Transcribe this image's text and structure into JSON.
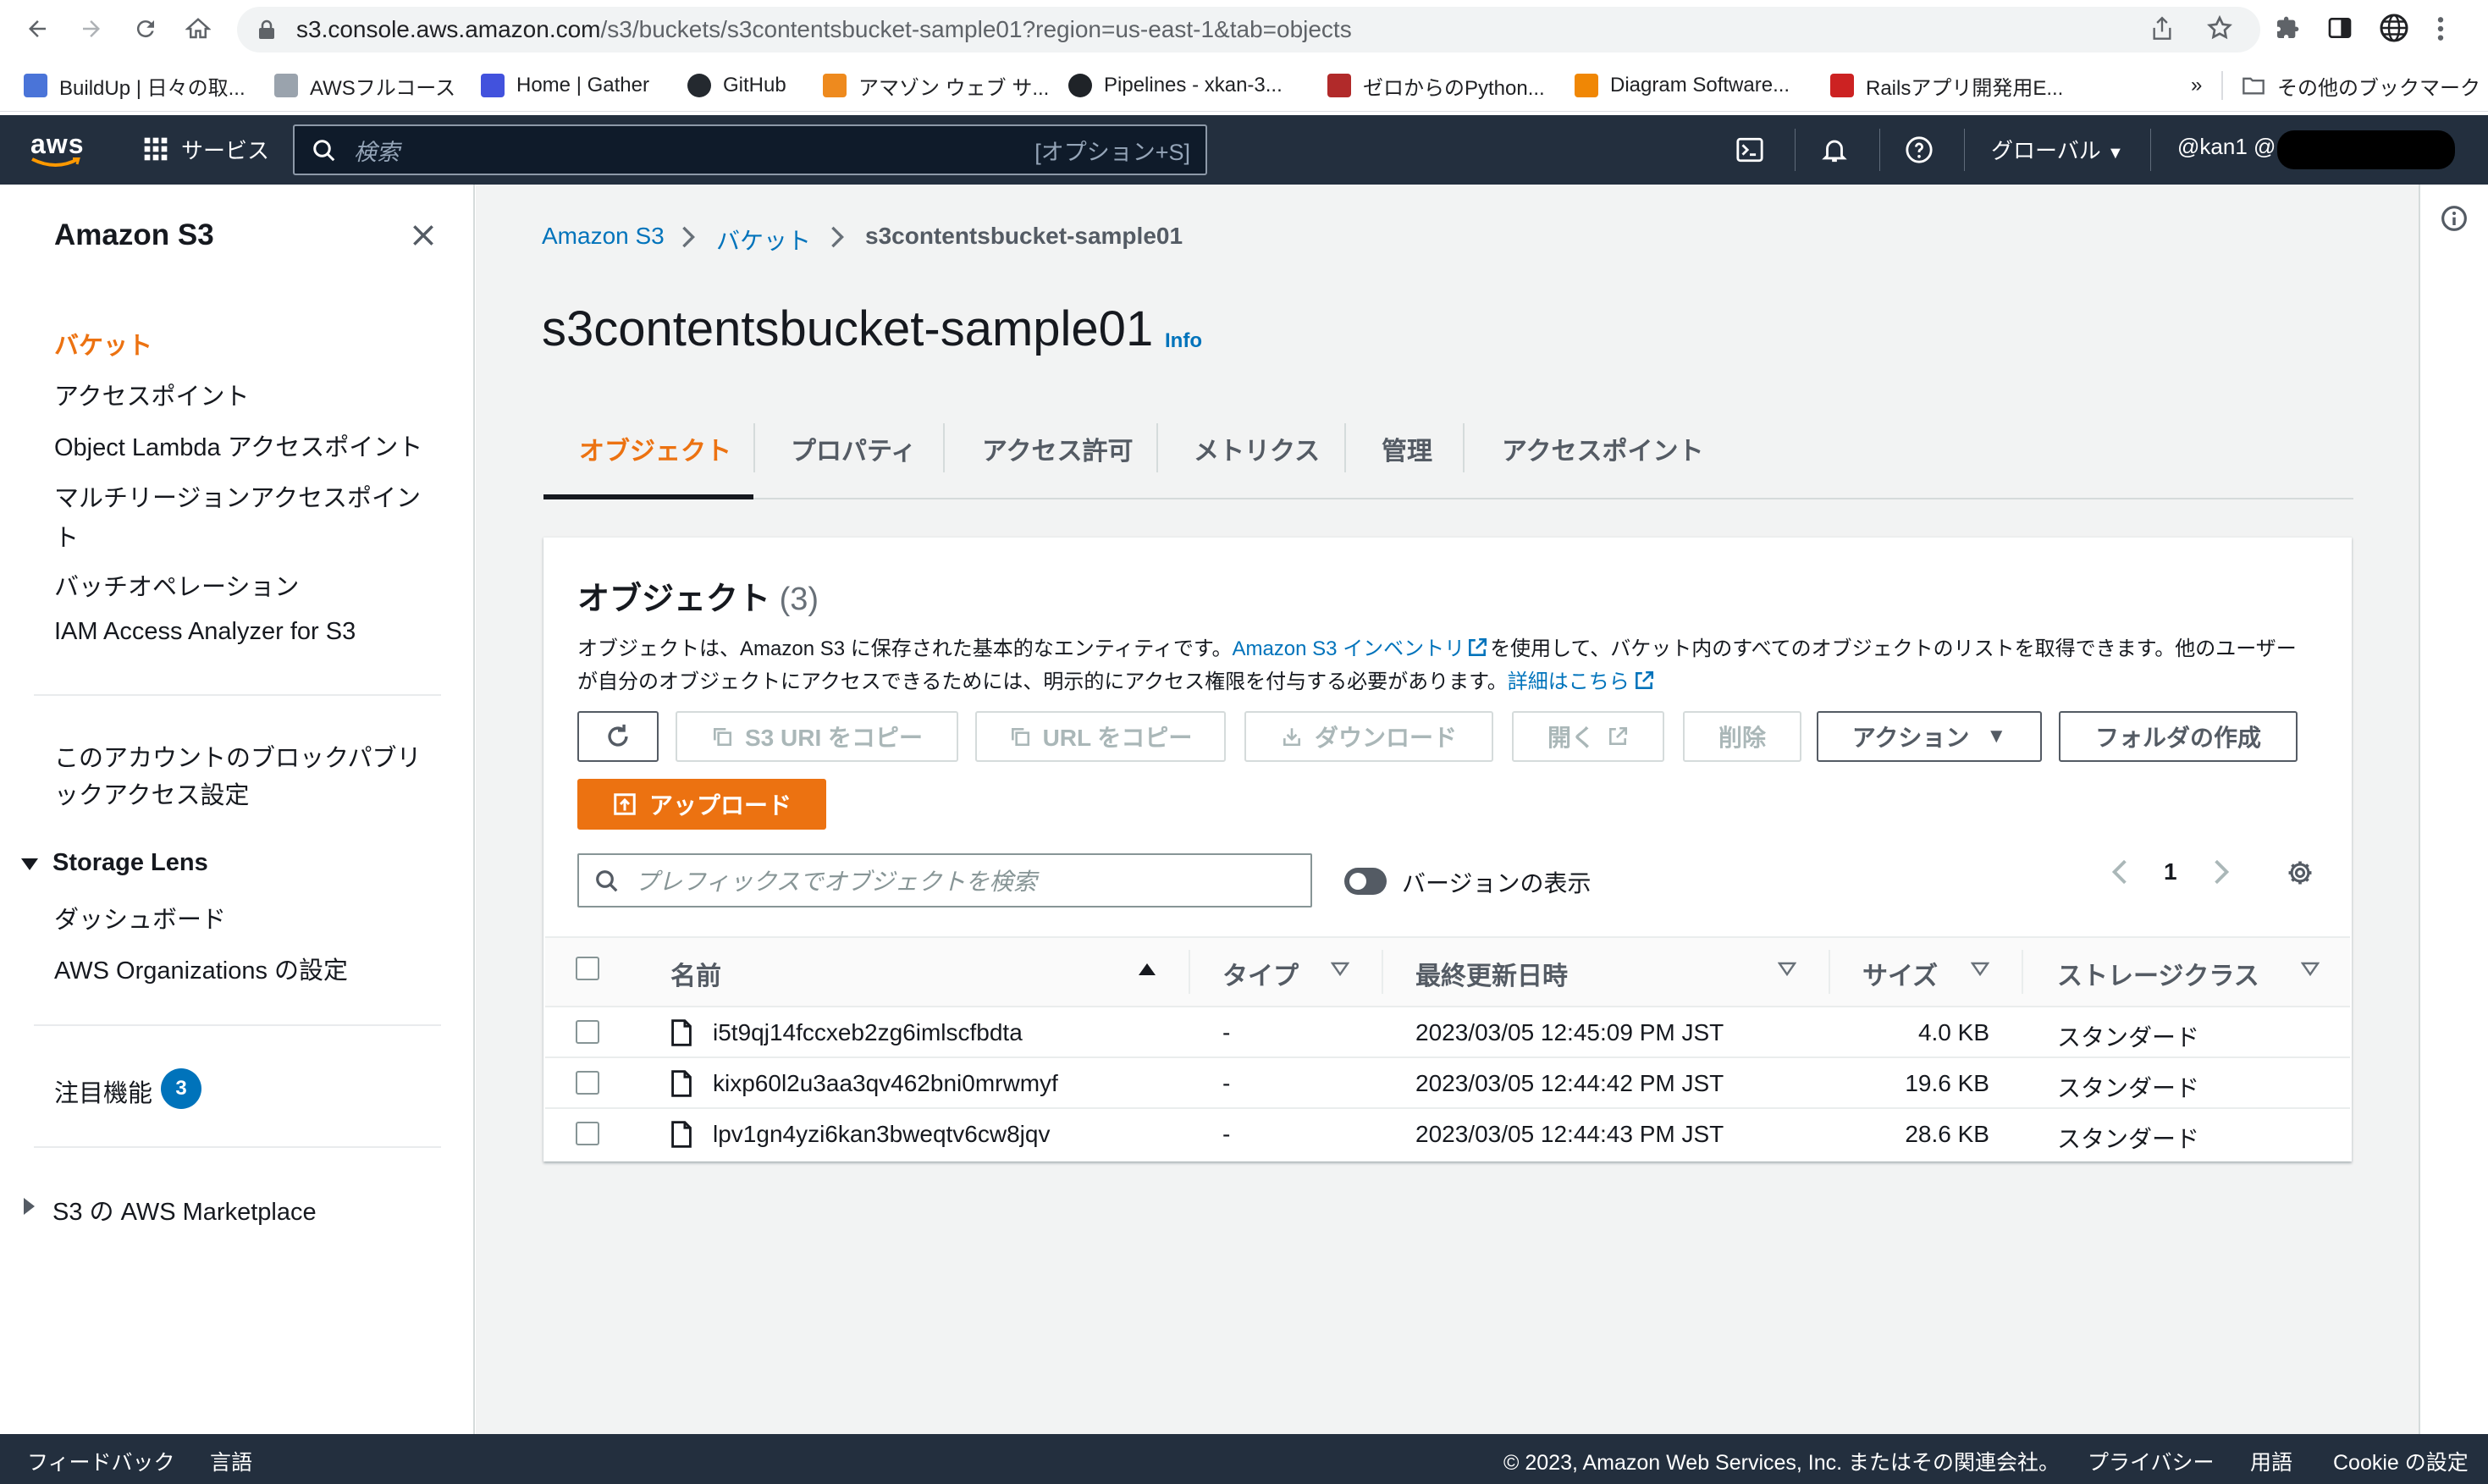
{
  "browser": {
    "url_host": "s3.console.aws.amazon.com",
    "url_path": "/s3/buckets/s3contentsbucket-sample01?region=us-east-1&tab=objects",
    "bookmarks": [
      {
        "label": "BuildUp | 日々の取...",
        "color": "#4a74d8"
      },
      {
        "label": "AWSフルコース",
        "color": "#9aa3ad"
      },
      {
        "label": "Home | Gather",
        "color": "#4252dd"
      },
      {
        "label": "GitHub",
        "color": "#24292f"
      },
      {
        "label": "アマゾン ウェブ サ...",
        "color": "#ee8a1e"
      },
      {
        "label": "Pipelines - xkan-3...",
        "color": "#1f2328"
      },
      {
        "label": "ゼロからのPython...",
        "color": "#b12a2a"
      },
      {
        "label": "Diagram Software...",
        "color": "#f08705"
      },
      {
        "label": "Railsアプリ開発用E...",
        "color": "#cc2222"
      }
    ],
    "bookmarks_more": "»",
    "other_bookmarks": "その他のブックマーク"
  },
  "header": {
    "logo": "aws",
    "services": "サービス",
    "search_placeholder": "検索",
    "search_shortcut": "[オプション+S]",
    "region": "グローバル",
    "account": "@kan1 @"
  },
  "sidenav": {
    "title": "Amazon S3",
    "items": [
      {
        "label": "バケット"
      },
      {
        "label": "アクセスポイント"
      },
      {
        "label": "Object Lambda アクセスポイント"
      },
      {
        "label": "マルチリージョンアクセスポイン"
      },
      {
        "label": "ト"
      },
      {
        "label": "バッチオペレーション"
      },
      {
        "label": "IAM Access Analyzer for S3"
      }
    ],
    "block_public_line1": "このアカウントのブロックパブリ",
    "block_public_line2": "ックアクセス設定",
    "storage_lens": "Storage Lens",
    "storage_lens_items": [
      {
        "label": "ダッシュボード"
      },
      {
        "label": "AWS Organizations の設定"
      }
    ],
    "featured": "注目機能",
    "featured_count": "3",
    "marketplace": "S3 の AWS Marketplace"
  },
  "breadcrumb": {
    "root": "Amazon S3",
    "buckets": "バケット",
    "current": "s3contentsbucket-sample01"
  },
  "page": {
    "title": "s3contentsbucket-sample01",
    "info": "Info"
  },
  "tabs": [
    {
      "label": "オブジェクト"
    },
    {
      "label": "プロパティ"
    },
    {
      "label": "アクセス許可"
    },
    {
      "label": "メトリクス"
    },
    {
      "label": "管理"
    },
    {
      "label": "アクセスポイント"
    }
  ],
  "objects_panel": {
    "title": "オブジェクト",
    "count": "(3)",
    "desc_1a": "オブジェクトは、Amazon S3 に保存された基本的なエンティティです。",
    "desc_1_link": "Amazon S3 インベントリ",
    "desc_1b": "を使用して、バケット内のすべてのオブジェクトのリストを取得できます。他のユーザー",
    "desc_2a": "が自分のオブジェクトにアクセスできるためには、明示的にアクセス権限を付与する必要があります。",
    "desc_2_link": "詳細はこちら",
    "buttons": {
      "copy_s3_uri": "S3 URI をコピー",
      "copy_url": "URL をコピー",
      "download": "ダウンロード",
      "open": "開く",
      "delete": "削除",
      "actions": "アクション",
      "create_folder": "フォルダの作成",
      "upload": "アップロード"
    },
    "search_placeholder": "プレフィックスでオブジェクトを検索",
    "show_versions": "バージョンの表示",
    "page_number": "1",
    "columns": {
      "name": "名前",
      "type": "タイプ",
      "modified": "最終更新日時",
      "size": "サイズ",
      "storage": "ストレージクラス"
    },
    "rows": [
      {
        "name": "i5t9qj14fccxeb2zg6imlscfbdta",
        "type": "-",
        "modified": "2023/03/05 12:45:09 PM JST",
        "size": "4.0 KB",
        "storage": "スタンダード"
      },
      {
        "name": "kixp60l2u3aa3qv462bni0mrwmyf",
        "type": "-",
        "modified": "2023/03/05 12:44:42 PM JST",
        "size": "19.6 KB",
        "storage": "スタンダード"
      },
      {
        "name": "lpv1gn4yzi6kan3bweqtv6cw8jqv",
        "type": "-",
        "modified": "2023/03/05 12:44:43 PM JST",
        "size": "28.6 KB",
        "storage": "スタンダード"
      }
    ]
  },
  "footer": {
    "feedback": "フィードバック",
    "language": "言語",
    "copyright": "© 2023, Amazon Web Services, Inc. またはその関連会社。",
    "privacy": "プライバシー",
    "terms": "用語",
    "cookie": "Cookie の設定"
  },
  "colors": {
    "link": "#0073bb",
    "active_tab": "#ec7211",
    "primary_button": "#ec7211",
    "header_bg": "#232f3e"
  }
}
